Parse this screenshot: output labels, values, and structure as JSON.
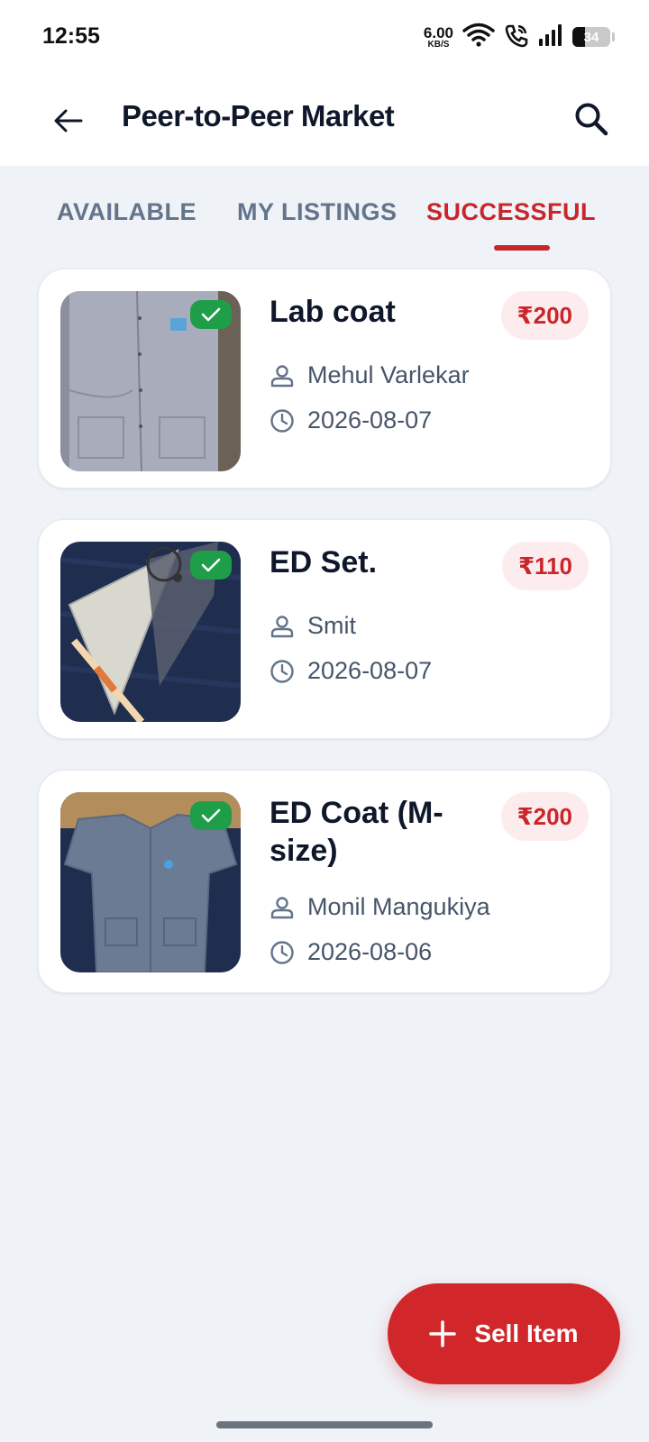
{
  "status": {
    "time": "12:55",
    "net_speed_value": "6.00",
    "net_speed_unit": "KB/S",
    "battery_level": "34",
    "battery_fraction": 0.34
  },
  "appbar": {
    "title": "Peer-to-Peer Market",
    "back_icon": "arrow-left-icon",
    "search_icon": "search-icon"
  },
  "tabs": [
    {
      "label": "AVAILABLE",
      "active": false
    },
    {
      "label": "MY LISTINGS",
      "active": false
    },
    {
      "label": "SUCCESSFUL",
      "active": true
    }
  ],
  "listings": [
    {
      "title": "Lab coat",
      "price": "₹200",
      "seller": "Mehul Varlekar",
      "date": "2026-08-07",
      "status_icon": "check-icon"
    },
    {
      "title": "ED Set.",
      "price": "₹110",
      "seller": "Smit",
      "date": "2026-08-07",
      "status_icon": "check-icon"
    },
    {
      "title": "ED Coat (M-size)",
      "price": "₹200",
      "seller": "Monil Mangukiya",
      "date": "2026-08-06",
      "status_icon": "check-icon"
    }
  ],
  "fab": {
    "label": "Sell Item",
    "icon": "plus-icon"
  },
  "colors": {
    "accent": "#c8262b",
    "fab": "#d1272b",
    "success": "#1e9e48",
    "price_bg": "#fdeced",
    "background": "#eff2f7"
  }
}
